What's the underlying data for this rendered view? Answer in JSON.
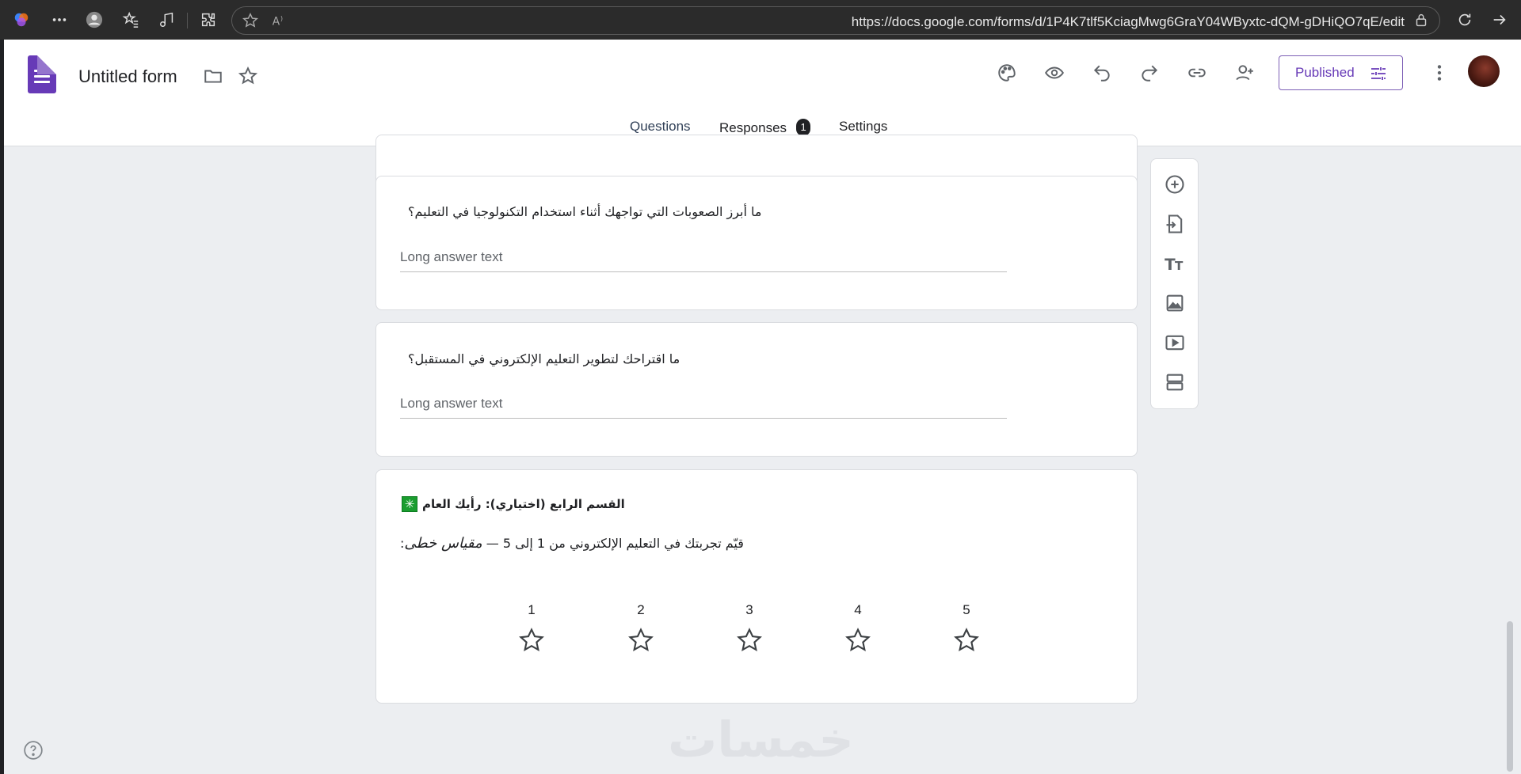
{
  "browser": {
    "url": "https://docs.google.com/forms/d/1P4K7tlf5KciagMwg6GraY04WByxtc-dQM-gDHiQO7qE/edit"
  },
  "header": {
    "title": "Untitled form",
    "publish_label": "Published"
  },
  "tabs": [
    {
      "label": "Questions",
      "active": true
    },
    {
      "label": "Responses",
      "badge": "1"
    },
    {
      "label": "Settings"
    }
  ],
  "questions": [
    {
      "title": "ما أبرز الصعوبات التي تواجهك أثناء استخدام التكنولوجيا في التعليم؟",
      "placeholder": "Long answer text"
    },
    {
      "title": "ما اقتراحك لتطوير التعليم الإلكتروني في المستقبل؟",
      "placeholder": "Long answer text"
    }
  ],
  "section": {
    "title": "القسم الرابع (اختياري): رأيك العام",
    "icon_symbol": "✳",
    "question_plain": "قيّم تجربتك في التعليم الإلكتروني من 1 إلى 5 — ",
    "question_italic": "مقياس خطى",
    "question_colon": ":",
    "scale": [
      "1",
      "2",
      "3",
      "4",
      "5"
    ],
    "rating_icon": "star-outline"
  },
  "watermark": "خمسات",
  "colors": {
    "brand": "#673ab7",
    "page_bg": "#eceef1",
    "active_tab": "#3c4a5f"
  }
}
